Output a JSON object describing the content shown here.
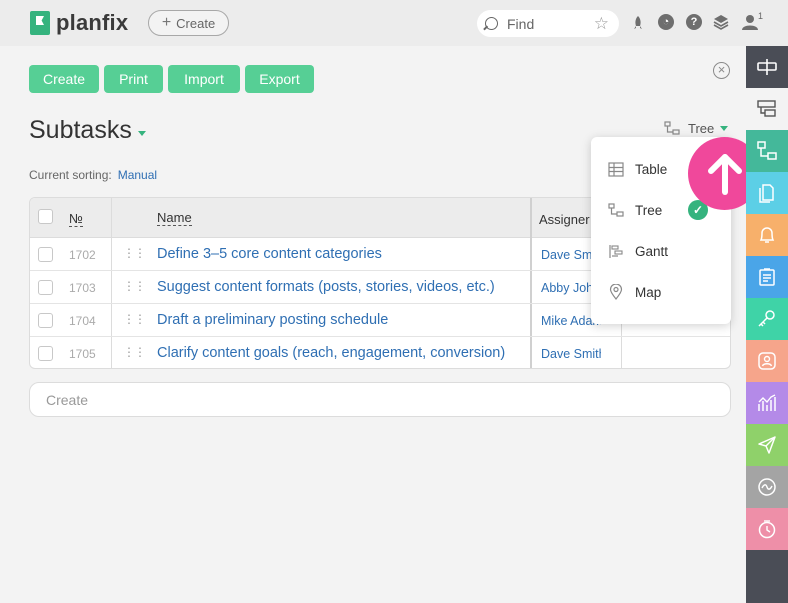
{
  "header": {
    "logo_text": "planfix",
    "create_label": "Create",
    "search_placeholder": "Find",
    "notification_count": "1"
  },
  "toolbar": {
    "create_label": "Create",
    "print_label": "Print",
    "import_label": "Import",
    "export_label": "Export"
  },
  "page": {
    "title": "Subtasks",
    "view_label": "Tree",
    "sorting_label": "Current sorting:",
    "sorting_value": "Manual"
  },
  "table": {
    "columns": {
      "number": "№",
      "name": "Name",
      "assignee": "Assigner"
    },
    "rows": [
      {
        "number": "1702",
        "name": "Define 3–5 core content categories",
        "assignee": "Dave Smith"
      },
      {
        "number": "1703",
        "name": "Suggest content formats (posts, stories, videos, etc.)",
        "assignee": "Abby Johnson"
      },
      {
        "number": "1704",
        "name": "Draft a preliminary posting schedule",
        "assignee": "Mike Adams"
      },
      {
        "number": "1705",
        "name": "Clarify content goals (reach, engagement, conversion)",
        "assignee": "Dave Smith"
      }
    ]
  },
  "create_input": {
    "placeholder": "Create"
  },
  "view_menu": {
    "items": [
      {
        "label": "Table",
        "icon": "table-icon"
      },
      {
        "label": "Tree",
        "icon": "tree-icon",
        "selected": true
      },
      {
        "label": "Gantt",
        "icon": "gantt-icon"
      },
      {
        "label": "Map",
        "icon": "map-pin-icon"
      }
    ]
  },
  "colors": {
    "accent_green": "#56cf95",
    "link_blue": "#2f6fb3",
    "highlight_pink": "#f0489b",
    "rail_dark": "#4a4d56"
  },
  "sidebar": {
    "items": [
      {
        "icon": "task-icon",
        "color": "#4a4d56"
      },
      {
        "icon": "board-icon",
        "color": "#f3f3f3"
      },
      {
        "icon": "subtasks-tree-icon",
        "color": "#44b89a"
      },
      {
        "icon": "documents-icon",
        "color": "#5ccfe6"
      },
      {
        "icon": "bell-icon",
        "color": "#f7b06b"
      },
      {
        "icon": "checklist-icon",
        "color": "#4aa5e8"
      },
      {
        "icon": "key-icon",
        "color": "#3fd3a7"
      },
      {
        "icon": "contact-icon",
        "color": "#f6a58b"
      },
      {
        "icon": "analytics-icon",
        "color": "#b48ae8"
      },
      {
        "icon": "send-icon",
        "color": "#8fd16a"
      },
      {
        "icon": "activity-icon",
        "color": "#a4a4a4"
      },
      {
        "icon": "clock-icon",
        "color": "#ee8fa8"
      }
    ]
  }
}
